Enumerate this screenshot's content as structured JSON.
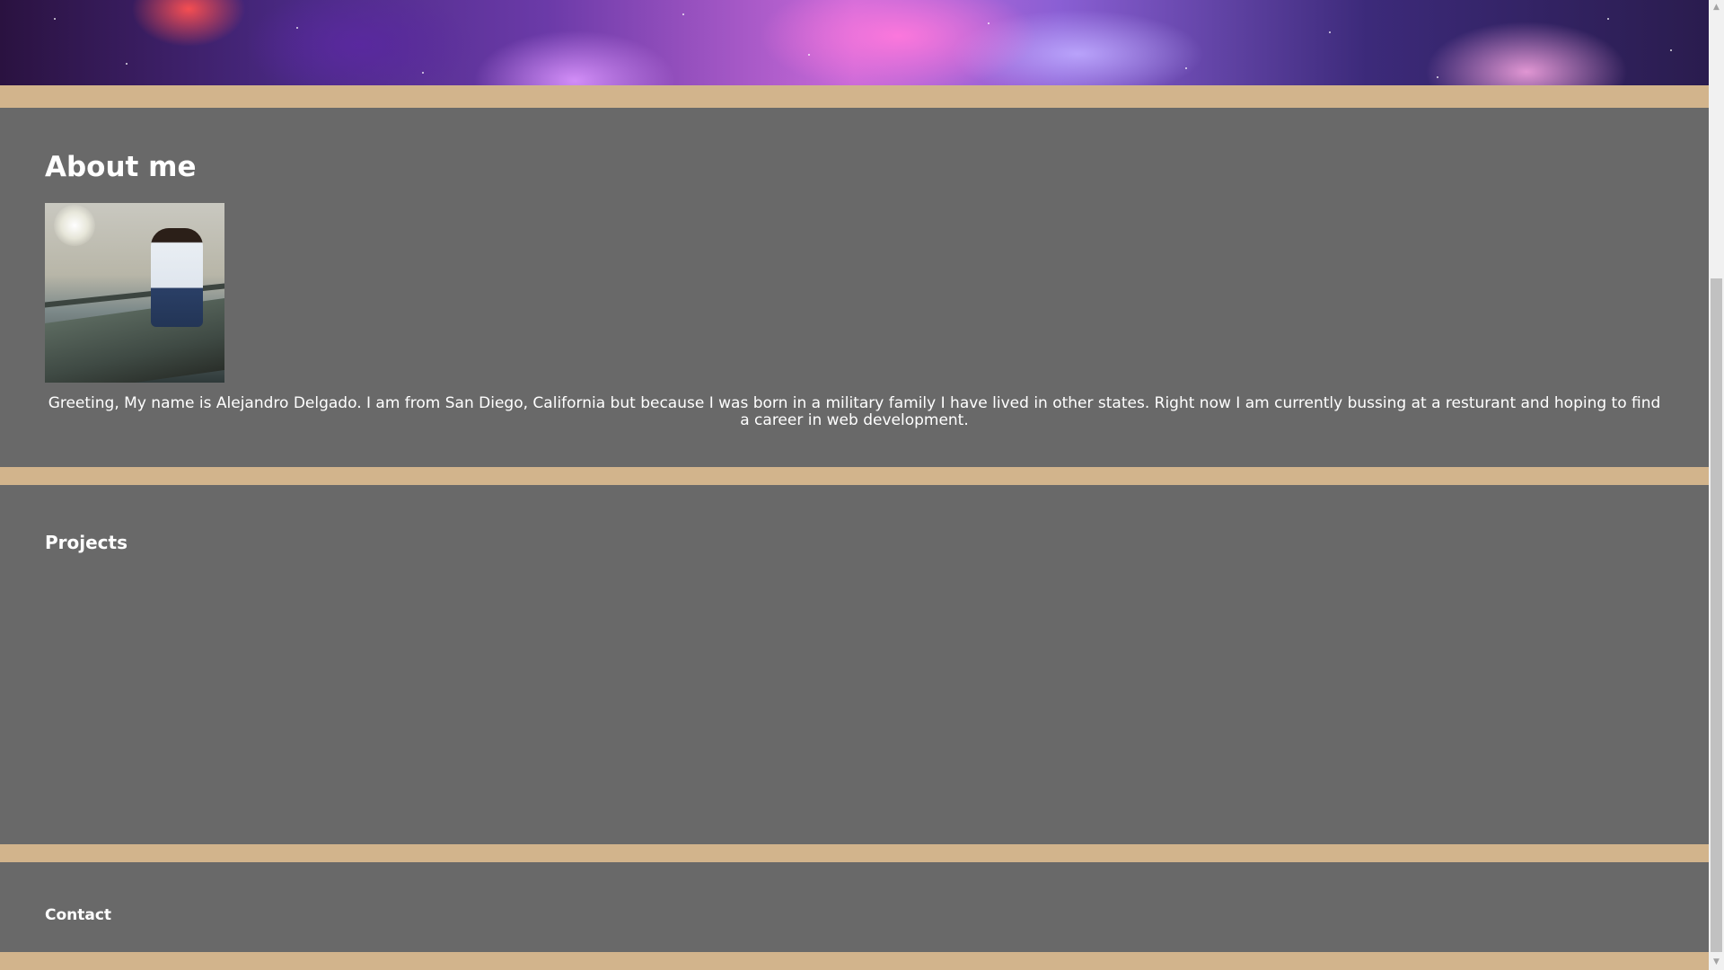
{
  "about": {
    "heading": "About me",
    "photo_alt": "Photo of Alejandro Delgado on a pier",
    "text": "Greeting, My name is Alejandro Delgado. I am from San Diego, California but because I was born in a military family I have lived in other states. Right now I am currently bussing at a resturant and hoping to find a career in web development."
  },
  "projects": {
    "heading": "Projects"
  },
  "contact": {
    "heading": "Contact"
  },
  "scrollbar": {
    "up_arrow": "▲",
    "down_arrow": "▼"
  },
  "colors": {
    "page_background": "#d2b48c",
    "section_background": "#696969",
    "text": "#ffffff"
  }
}
